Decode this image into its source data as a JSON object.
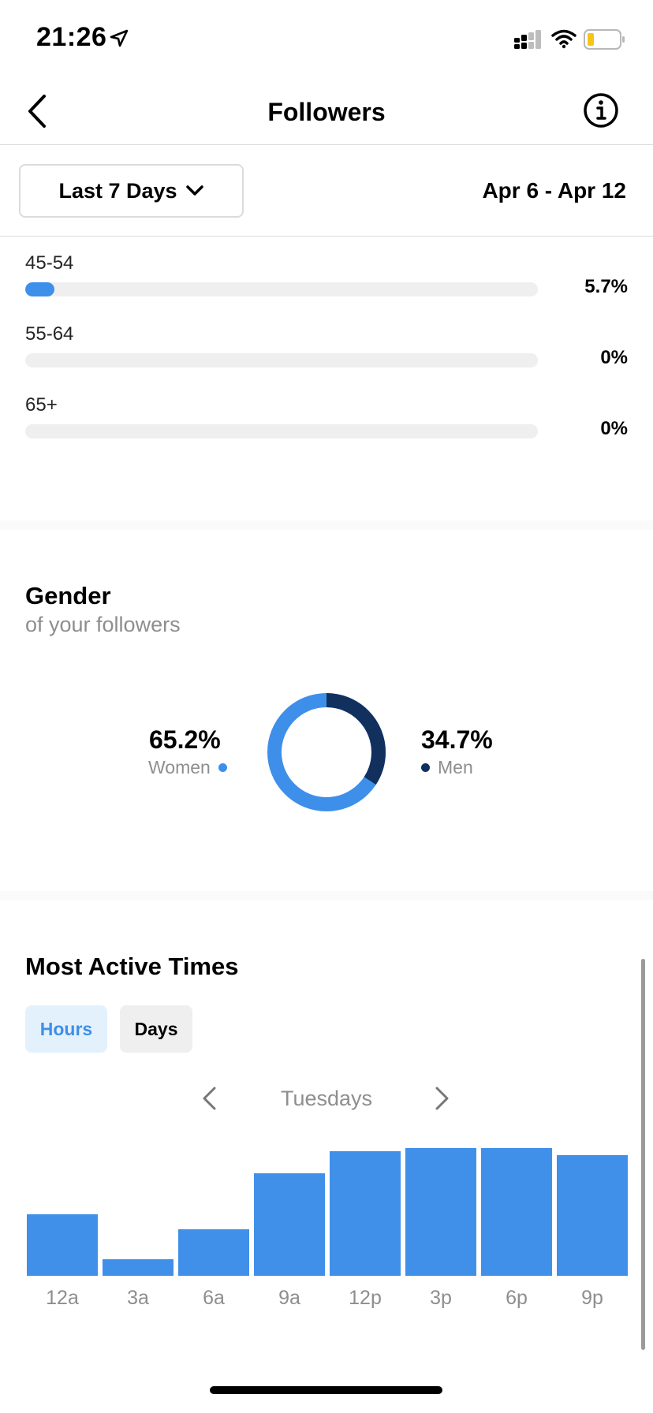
{
  "status_bar": {
    "time": "21:26"
  },
  "nav": {
    "title": "Followers"
  },
  "filter": {
    "range_label": "Last 7 Days",
    "date_range": "Apr 6 - Apr 12"
  },
  "age": [
    {
      "label": "45-54",
      "value": "5.7%",
      "fraction": 0.057
    },
    {
      "label": "55-64",
      "value": "0%",
      "fraction": 0
    },
    {
      "label": "65+",
      "value": "0%",
      "fraction": 0
    }
  ],
  "gender": {
    "title": "Gender",
    "subtitle": "of your followers",
    "women": {
      "value": "65.2%",
      "label": "Women",
      "fraction": 0.652,
      "color": "#3e8fea"
    },
    "men": {
      "value": "34.7%",
      "label": "Men",
      "fraction": 0.347,
      "color": "#12305e"
    }
  },
  "active_times": {
    "title": "Most Active Times",
    "tabs": {
      "hours": "Hours",
      "days": "Days"
    },
    "day": "Tuesdays"
  },
  "chart_data": {
    "type": "bar",
    "categories": [
      "12a",
      "3a",
      "6a",
      "9a",
      "12p",
      "3p",
      "6p",
      "9p"
    ],
    "values": [
      44,
      12,
      33,
      73,
      89,
      91,
      91,
      86
    ],
    "ylim": [
      0,
      100
    ],
    "color": "#4090ea"
  }
}
